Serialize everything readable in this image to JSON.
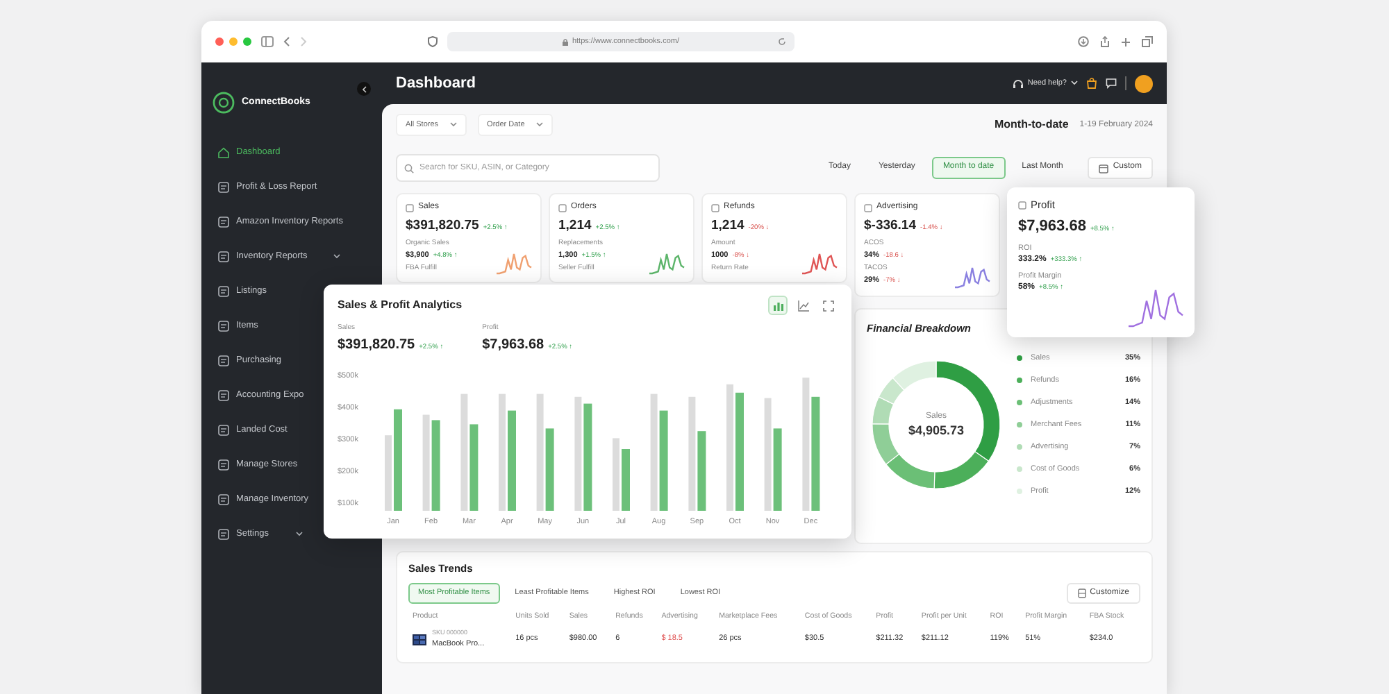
{
  "browser": {
    "url": "https://www.connectbooks.com/"
  },
  "sidebar": {
    "logo": "ConnectBooks",
    "items": [
      {
        "label": "Dashboard",
        "selected": true,
        "has_submenu": false
      },
      {
        "label": "Profit & Loss Report",
        "selected": false,
        "has_submenu": false
      },
      {
        "label": "Amazon Inventory Reports",
        "selected": false,
        "has_submenu": false
      },
      {
        "label": "Inventory Reports",
        "selected": false,
        "has_submenu": true
      },
      {
        "label": "Listings",
        "selected": false,
        "has_submenu": false
      },
      {
        "label": "Items",
        "selected": false,
        "has_submenu": false
      },
      {
        "label": "Purchasing",
        "selected": false,
        "has_submenu": false
      },
      {
        "label": "Accounting Expo",
        "selected": false,
        "has_submenu": false
      },
      {
        "label": "Landed Cost",
        "selected": false,
        "has_submenu": false
      },
      {
        "label": "Manage Stores",
        "selected": false,
        "has_submenu": false
      },
      {
        "label": "Manage Inventory",
        "selected": false,
        "has_submenu": false
      },
      {
        "label": "Settings",
        "selected": false,
        "has_submenu": true
      }
    ]
  },
  "header": {
    "title": "Dashboard",
    "help": "Need help?"
  },
  "filters": [
    {
      "label": "All Stores"
    },
    {
      "label": "Order Date"
    }
  ],
  "period": {
    "label": "Month-to-date",
    "range": "1-19 February 2024"
  },
  "search": {
    "placeholder": "Search for SKU, ASIN, or Category"
  },
  "ranges": [
    {
      "label": "Today",
      "selected": false
    },
    {
      "label": "Yesterday",
      "selected": false
    },
    {
      "label": "Month to date",
      "selected": true
    },
    {
      "label": "Last Month",
      "selected": false
    }
  ],
  "custom": "Custom",
  "kpis": [
    {
      "label": "Sales",
      "value": "$391,820.75",
      "change": "+2.5% ↑",
      "negative": false,
      "color": "#f0a070",
      "metrics": [
        {
          "label": "Organic Sales",
          "value": "$3,900",
          "change": "+4.8% ↑",
          "negative": false
        },
        {
          "label": "FBA Fulfill"
        }
      ]
    },
    {
      "label": "Orders",
      "value": "1,214",
      "change": "+2.5% ↑",
      "negative": false,
      "color": "#5cb56a",
      "metrics": [
        {
          "label": "Replacements",
          "value": "1,300",
          "change": "+1.5% ↑",
          "negative": false
        },
        {
          "label": "Seller Fulfill"
        }
      ]
    },
    {
      "label": "Refunds",
      "value": "1,214",
      "change": "-20% ↓",
      "negative": true,
      "color": "#e05555",
      "metrics": [
        {
          "label": "Amount",
          "value": "1000",
          "change": "-8% ↓",
          "negative": true
        },
        {
          "label": "Return Rate"
        }
      ]
    },
    {
      "label": "Advertising",
      "value": "$-336.14",
      "change": "-1.4% ↓",
      "negative": true,
      "color": "#8a80e0",
      "metrics": [
        {
          "label": "ACOS",
          "value": "34%",
          "change": "-18.6 ↓",
          "negative": true
        },
        {
          "label": "TACOS",
          "value": "29%",
          "change": "-7% ↓",
          "negative": true
        }
      ]
    }
  ],
  "profit_card": {
    "label": "Profit",
    "value": "$7,963.68",
    "change": "+8.5% ↑",
    "negative": false,
    "color": "#a070e0",
    "metrics": [
      {
        "label": "ROI",
        "value": "333.2%",
        "change": "+333.3% ↑",
        "negative": false
      },
      {
        "label": "Profit Margin",
        "value": "58%",
        "change": "+8.5% ↑",
        "negative": false
      }
    ]
  },
  "analytics": {
    "title": "Sales & Profit Analytics",
    "view_buttons": [
      {
        "kind": "bar",
        "selected": true
      },
      {
        "kind": "line",
        "selected": false
      },
      {
        "kind": "expand",
        "selected": false
      }
    ],
    "metrics": [
      {
        "label": "Sales",
        "value": "$391,820.75",
        "change": "+2.5% ↑"
      },
      {
        "label": "Profit",
        "value": "$7,963.68",
        "change": "+2.5% ↑"
      }
    ],
    "chart_data": {
      "type": "bar",
      "categories": [
        "Jan",
        "Feb",
        "Mar",
        "Apr",
        "May",
        "Jun",
        "Jul",
        "Aug",
        "Sep",
        "Oct",
        "Nov",
        "Dec"
      ],
      "series": [
        {
          "color": "#dcdcdc",
          "values": [
            311000,
            375000,
            440000,
            440000,
            440000,
            431000,
            302000,
            440000,
            431000,
            470000,
            427000,
            491000
          ]
        },
        {
          "color": "#6cc07a",
          "values": [
            392000,
            358000,
            345000,
            388000,
            332000,
            410000,
            268000,
            388000,
            324000,
            444000,
            332000,
            431000
          ]
        }
      ],
      "ylim": [
        75000,
        500000
      ],
      "yticks": [
        {
          "value": 100000,
          "label": "$100k"
        },
        {
          "value": 200000,
          "label": "$200k"
        },
        {
          "value": 300000,
          "label": "$300k"
        },
        {
          "value": 400000,
          "label": "$400k"
        },
        {
          "value": 500000,
          "label": "$500k"
        }
      ]
    }
  },
  "breakdown": {
    "title": "Financial Breakdown",
    "center_label": "Sales",
    "center_value": "$4,905.73",
    "chart_data": {
      "type": "donut",
      "categories": [
        "Sales",
        "Refunds",
        "Adjustments",
        "Merchant Fees",
        "Advertising",
        "Cost of Goods",
        "Profit"
      ],
      "values": [
        35,
        16,
        14,
        11,
        7,
        6,
        12
      ]
    },
    "legend": [
      {
        "value": "35%",
        "color": "#2f9e44"
      },
      {
        "value": "16%",
        "color": "#4caf5a"
      },
      {
        "value": "14%",
        "color": "#6bbf76"
      },
      {
        "value": "11%",
        "color": "#8fce97"
      },
      {
        "value": "7%",
        "color": "#b0dcb5"
      },
      {
        "value": "6%",
        "color": "#c9e7cc"
      },
      {
        "value": "12%",
        "color": "#dff1e1"
      }
    ]
  },
  "sales_trends": {
    "title": "Sales Trends",
    "tabs": [
      {
        "label": "Most Profitable Items",
        "selected": true
      },
      {
        "label": "Least Profitable Items",
        "selected": false
      },
      {
        "label": "Highest ROI",
        "selected": false
      },
      {
        "label": "Lowest ROI",
        "selected": false
      }
    ],
    "customize": "Customize",
    "columns": [
      "Product",
      "Units Sold",
      "Sales",
      "Refunds",
      "Advertising",
      "Marketplace Fees",
      "Cost of Goods",
      "Profit",
      "Profit per Unit",
      "ROI",
      "Profit Margin",
      "FBA Stock"
    ],
    "rows": [
      {
        "cells": [
          {
            "kind": "product",
            "sku": "SKU 000000",
            "name": "MacBook Pro..."
          },
          {
            "kind": "text",
            "text": "16 pcs",
            "negative": false
          },
          {
            "kind": "text",
            "text": "$980.00",
            "negative": false
          },
          {
            "kind": "text",
            "text": "6",
            "negative": false
          },
          {
            "kind": "text",
            "text": "$ 18.5",
            "negative": true
          },
          {
            "kind": "text",
            "text": "26 pcs",
            "negative": false
          },
          {
            "kind": "text",
            "text": "$30.5",
            "negative": false
          },
          {
            "kind": "text",
            "text": "$211.32",
            "negative": false
          },
          {
            "kind": "text",
            "text": "$211.12",
            "negative": false
          },
          {
            "kind": "text",
            "text": "119%",
            "negative": false
          },
          {
            "kind": "text",
            "text": "51%",
            "negative": false
          },
          {
            "kind": "text",
            "text": "$234.0",
            "negative": false
          }
        ]
      }
    ]
  }
}
